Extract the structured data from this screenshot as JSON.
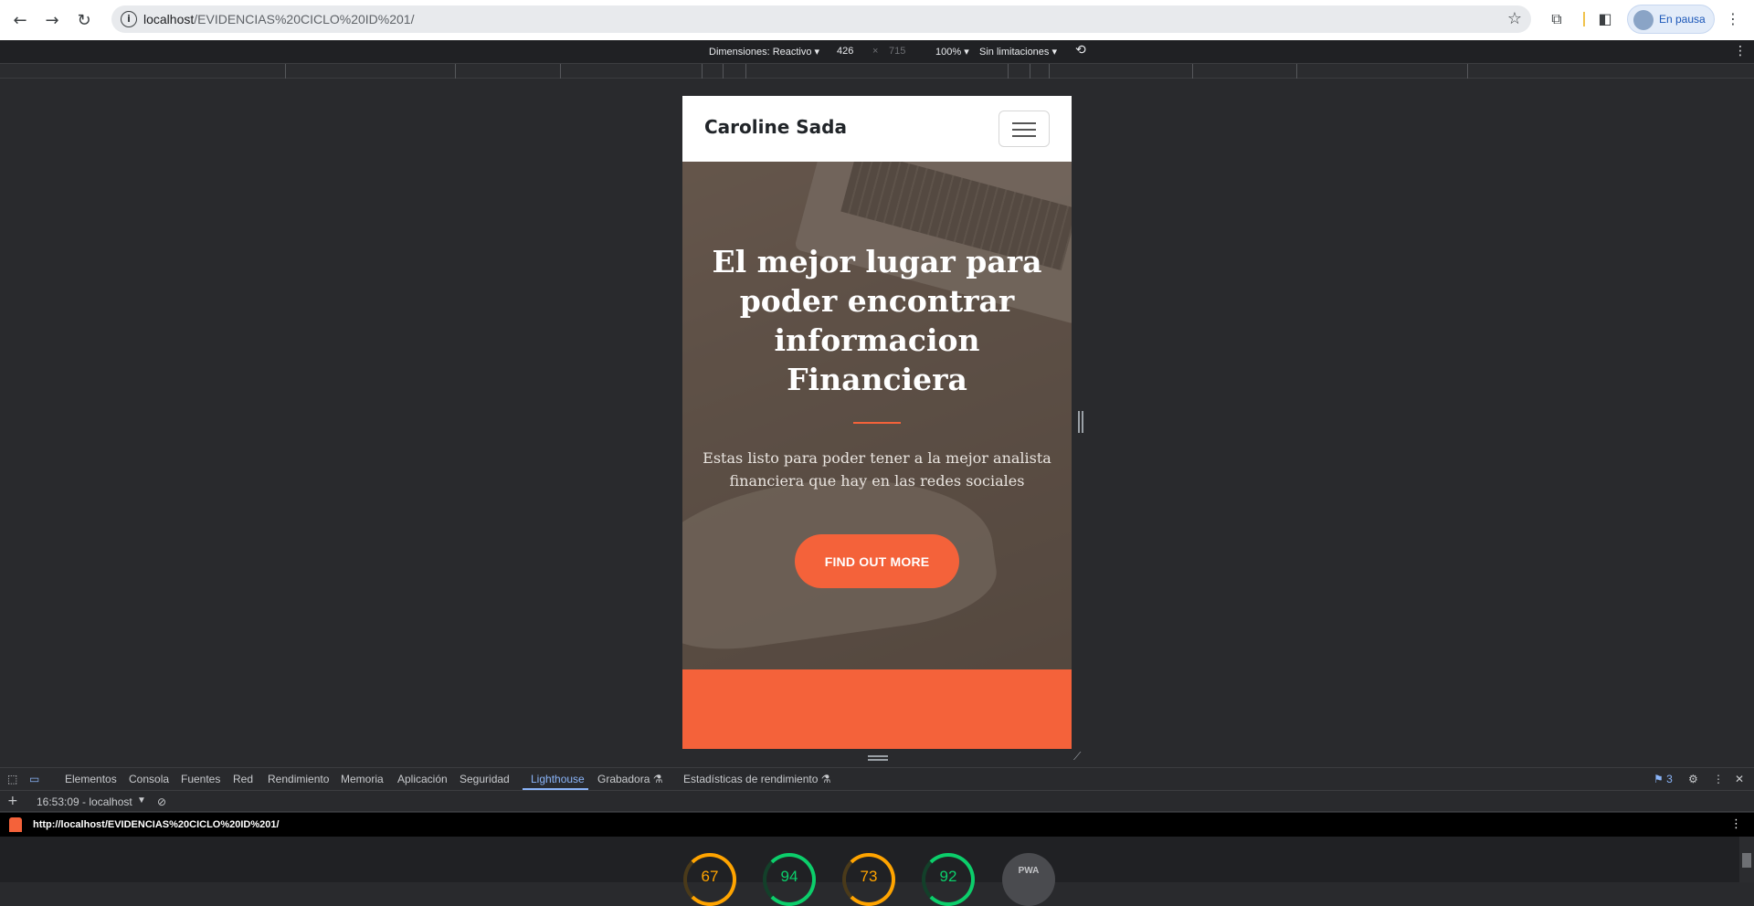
{
  "browser": {
    "url_host": "localhost",
    "url_path": "/EVIDENCIAS%20CICLO%20ID%201/",
    "profile_label": "En pausa"
  },
  "device_toolbar": {
    "dimensions_label": "Dimensiones: Reactivo ▾",
    "width_value": "426",
    "times": "×",
    "height_value": "715",
    "zoom": "100% ▾",
    "throttle": "Sin limitaciones ▾"
  },
  "site": {
    "brand": "Caroline Sada",
    "hero_title": "El mejor lugar para poder encontrar informacion Financiera",
    "hero_subtitle": "Estas listo para poder tener a la mejor analista financiera que hay en las redes sociales",
    "cta_label": "FIND OUT MORE"
  },
  "devtools": {
    "tabs": [
      "Elementos",
      "Consola",
      "Fuentes",
      "Red",
      "Rendimiento",
      "Memoria",
      "Aplicación",
      "Seguridad",
      "Lighthouse",
      "Grabadora ⚗",
      "Estadísticas de rendimiento ⚗"
    ],
    "issues_count": "3",
    "report_selector": "16:53:09 - localhost",
    "report_url": "http://localhost/EVIDENCIAS%20CICLO%20ID%201/",
    "scores": [
      "67",
      "94",
      "73",
      "92"
    ],
    "pwa_label": "PWA"
  },
  "colors": {
    "accent": "#f4623a",
    "score_orange": "#ffa400",
    "score_green": "#0cce6b"
  }
}
